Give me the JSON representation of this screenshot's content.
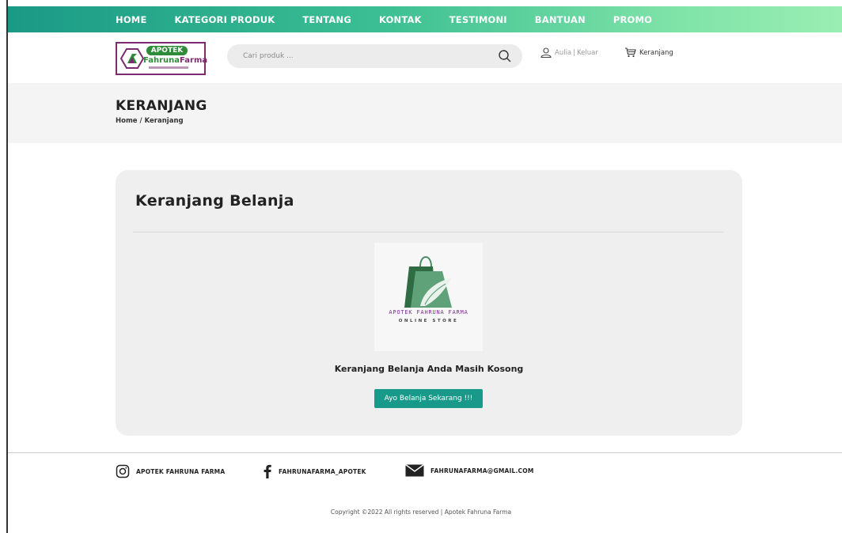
{
  "nav": {
    "items": [
      "HOME",
      "KATEGORI PRODUK",
      "TENTANG",
      "KONTAK",
      "TESTIMONI",
      "BANTUAN",
      "PROMO"
    ]
  },
  "header": {
    "logo": {
      "badge": "APOTEK",
      "brand_part1": "Fahruna",
      "brand_part2": "Farma"
    },
    "search": {
      "placeholder": "Cari produk ...",
      "icon": "search-icon"
    },
    "user": {
      "name": "Aulia",
      "separator": "|",
      "logout": "Keluar",
      "icon": "user-icon"
    },
    "cart": {
      "label": "Keranjang",
      "icon": "cart-icon"
    }
  },
  "page": {
    "title": "KERANJANG",
    "breadcrumb": {
      "home": "Home",
      "separator": " / ",
      "current": "Keranjang"
    }
  },
  "cart_card": {
    "heading": "Keranjang Belanja",
    "store_logo": {
      "name": "APOTEK FAHRUNA FARMA",
      "subtitle": "ONLINE STORE"
    },
    "empty_message": "Keranjang Belanja Anda Masih Kosong",
    "cta_label": "Ayo Belanja Sekarang !!!"
  },
  "footer": {
    "social": [
      {
        "icon": "instagram-icon",
        "label": "APOTEK FAHRUNA FARMA"
      },
      {
        "icon": "facebook-icon",
        "label": "FAHRUNAFARMA_APOTEK"
      },
      {
        "icon": "mail-icon",
        "label": "FAHRUNAFARMA@GMAIL.COM"
      }
    ],
    "copyright": "Copyright ©2022 All rights reserved | Apotek Fahruna Farma"
  },
  "colors": {
    "nav_gradient_start": "#1a9a86",
    "nav_gradient_end": "#9aeeb3",
    "accent": "#19998a",
    "logo_purple": "#7b2b6e",
    "logo_green": "#2e8b3a"
  }
}
